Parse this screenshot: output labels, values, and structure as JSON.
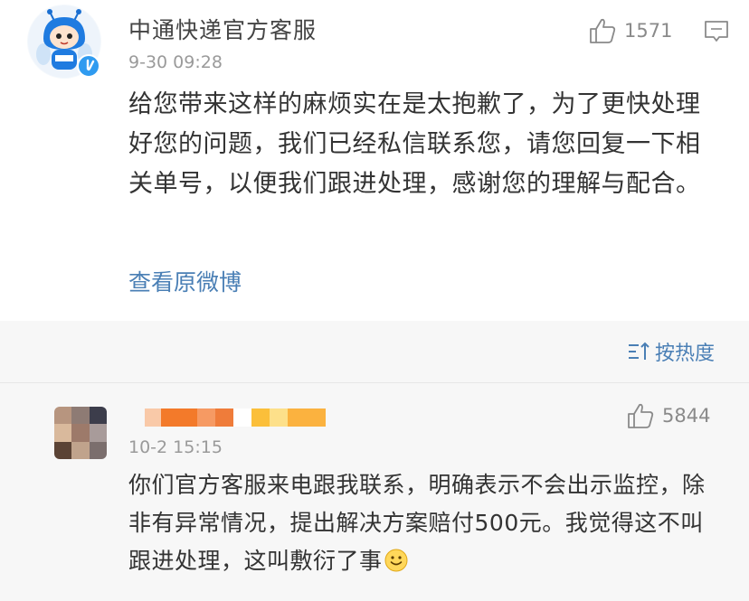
{
  "official_comment": {
    "username": "中通快递官方客服",
    "timestamp": "9-30 09:28",
    "like_count": "1571",
    "text": "给您带来这样的麻烦实在是太抱歉了，为了更快处理好您的问题，我们已经私信联系您，请您回复一下相关单号，以便我们跟进处理，感谢您的理解与配合。",
    "view_original_label": "查看原微博",
    "avatar_icon": "bee-mascot-avatar",
    "verified_icon": "verified-badge-icon",
    "like_icon": "thumbs-up-icon",
    "reply_icon": "comment-bubble-icon"
  },
  "sort": {
    "label": "按热度",
    "icon": "sort-by-heat-icon"
  },
  "user_comment": {
    "timestamp": "10-2 15:15",
    "like_count": "5844",
    "text": "你们官方客服来电跟我联系，明确表示不会出示监控，除非有异常情况，提出解决方案赔付500元。我觉得这不叫跟进处理，这叫敷衍了事",
    "avatar_icon": "pixelated-avatar",
    "username_icon": "pixelated-username",
    "emoji_icon": "smile-emoji-icon"
  },
  "colors": {
    "accent_blue": "#4a7fb5",
    "verified_blue": "#2f9bf0",
    "text_main": "#333333",
    "text_muted": "#9a9a9a",
    "band_bg": "#f7f7f7"
  }
}
